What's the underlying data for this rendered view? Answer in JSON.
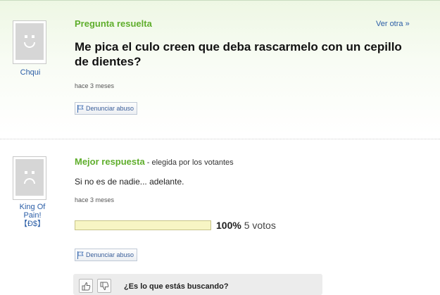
{
  "question": {
    "status_label": "Pregunta resuelta",
    "next_link": "Ver otra »",
    "title": "Me pica el culo creen que deba rascarmelo con un cepillo de dientes?",
    "asker": "Chqui",
    "time": "hace 3 meses",
    "report_label": "Denunciar abuso"
  },
  "best_answer": {
    "heading": "Mejor respuesta",
    "chosen_by": " - elegida por los votantes",
    "text": "Si no es de nadie... adelante.",
    "time": "hace 3 meses",
    "answerer_line1": "King Of",
    "answerer_line2": "Pain!",
    "answerer_line3": "【Ð$】",
    "vote_percent_label": "100%",
    "vote_percent": 100,
    "votes_label": "5 votos",
    "report_label": "Denunciar abuso"
  },
  "feedback": {
    "prompt": "¿Es lo que estás buscando?"
  },
  "icons": {
    "report": "flag-icon",
    "thumbs_up": "thumbs-up-icon",
    "thumbs_down": "thumbs-down-icon"
  },
  "colors": {
    "accent_green": "#5fae2c",
    "link_blue": "#2a5da6"
  }
}
